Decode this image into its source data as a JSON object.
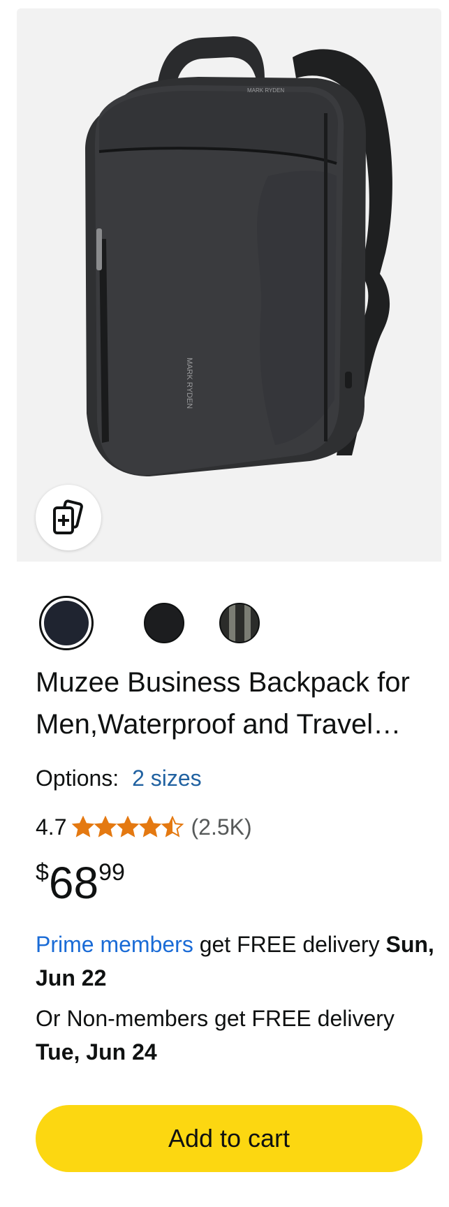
{
  "product": {
    "image_alt": "Black backpack",
    "brand_print_top": "MARK RYDEN",
    "brand_print_side": "MARK RYDEN",
    "compare_icon": "add-to-compare-icon",
    "swatches": [
      {
        "name": "navy-black",
        "color": "#1f2430",
        "selected": true
      },
      {
        "name": "black",
        "color": "#1c1d1f",
        "selected": false
      },
      {
        "name": "dark-grey",
        "color": "#2b2c2a",
        "selected": false
      }
    ],
    "title": "Muzee Business Backpack for Men,Waterproof and Travel Laptop Backpack",
    "options_label": "Options:",
    "options_link": "2 sizes",
    "rating_value": "4.7",
    "rating_stars": 4.7,
    "rating_count": "(2.5K)",
    "star_color": "#e47911",
    "price_symbol": "$",
    "price_whole": "68",
    "price_fraction": "99"
  },
  "delivery": {
    "prime_link": "Prime members",
    "prime_text": " get FREE delivery ",
    "prime_date": "Sun, Jun 22",
    "nonmember_text": "Or Non-members get FREE delivery ",
    "nonmember_date": "Tue, Jun 24"
  },
  "cta": {
    "add_to_cart": "Add to cart",
    "color": "#fcd711"
  }
}
